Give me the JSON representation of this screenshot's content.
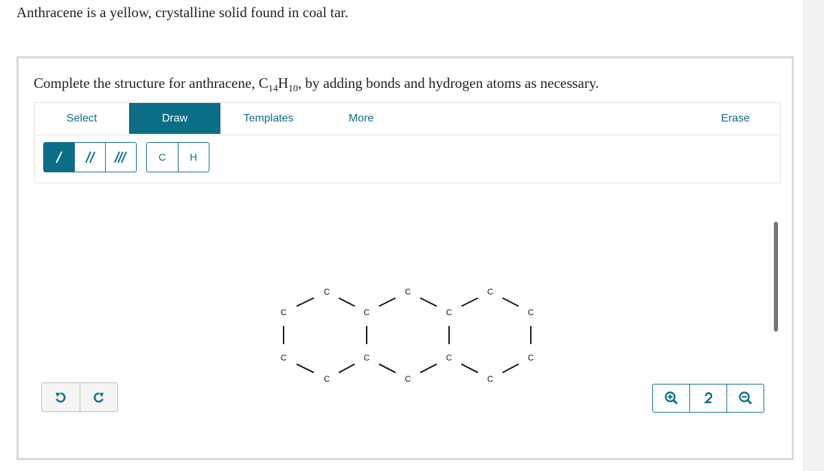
{
  "intro_text": "Anthracene is a yellow, crystalline solid found in coal tar.",
  "question": {
    "before": "Complete the structure for anthracene, C",
    "sub1": "14",
    "mid": "H",
    "sub2": "10",
    "after": ", by adding bonds and hydrogen atoms as necessary."
  },
  "toolbar": {
    "tabs": [
      {
        "label": "Select",
        "active": false
      },
      {
        "label": "Draw",
        "active": true
      },
      {
        "label": "Templates",
        "active": false
      },
      {
        "label": "More",
        "active": false
      }
    ],
    "erase_label": "Erase",
    "bond_tools": [
      "single-bond",
      "double-bond",
      "triple-bond"
    ],
    "atom_tools": [
      "C",
      "H"
    ]
  },
  "canvas": {
    "undo": "undo-icon",
    "redo": "redo-icon",
    "zoom_in": "zoom-in-icon",
    "reset": "reset-zoom-icon",
    "zoom_out": "zoom-out-icon",
    "accent_color": "#0a6e86",
    "molecule": {
      "atoms": [
        {
          "id": "a1",
          "label": "C"
        },
        {
          "id": "a2",
          "label": "C"
        },
        {
          "id": "a3",
          "label": "C"
        },
        {
          "id": "a4",
          "label": "C"
        },
        {
          "id": "a5",
          "label": "C"
        },
        {
          "id": "a6",
          "label": "C"
        },
        {
          "id": "a7",
          "label": "C"
        },
        {
          "id": "a8",
          "label": "C"
        },
        {
          "id": "a9",
          "label": "C"
        },
        {
          "id": "a10",
          "label": "C"
        },
        {
          "id": "a11",
          "label": "C"
        },
        {
          "id": "a12",
          "label": "C"
        },
        {
          "id": "a13",
          "label": "C"
        },
        {
          "id": "a14",
          "label": "C"
        }
      ],
      "bonds": [
        [
          "a1",
          "a2"
        ],
        [
          "a2",
          "a3"
        ],
        [
          "a3",
          "a4"
        ],
        [
          "a4",
          "a5"
        ],
        [
          "a5",
          "a6"
        ],
        [
          "a6",
          "a1"
        ],
        [
          "a6",
          "a7"
        ],
        [
          "a7",
          "a8"
        ],
        [
          "a8",
          "a9"
        ],
        [
          "a9",
          "a10"
        ],
        [
          "a10",
          "a5"
        ],
        [
          "a8",
          "a11"
        ],
        [
          "a11",
          "a12"
        ],
        [
          "a12",
          "a13"
        ],
        [
          "a13",
          "a14"
        ],
        [
          "a14",
          "a9"
        ]
      ]
    }
  }
}
